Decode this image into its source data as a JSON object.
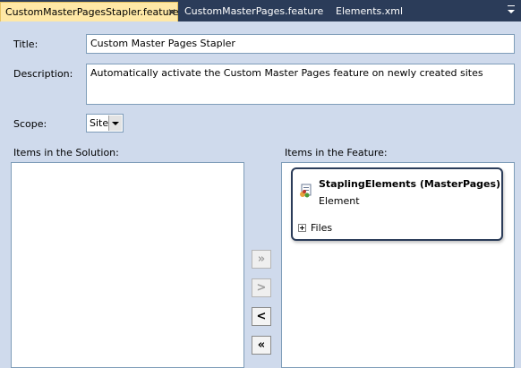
{
  "tabs": [
    {
      "label": "CustomMasterPagesStapler.feature",
      "active": true,
      "close_glyph": "✕"
    },
    {
      "label": "CustomMasterPages.feature",
      "active": false
    },
    {
      "label": "Elements.xml",
      "active": false
    }
  ],
  "tab_overflow_icon": "dropdown-icon",
  "form": {
    "title_label": "Title:",
    "title_value": "Custom Master Pages Stapler",
    "description_label": "Description:",
    "description_value": "Automatically activate the Custom Master Pages feature on newly created sites",
    "scope_label": "Scope:",
    "scope_value": "Site"
  },
  "solution_items": {
    "label": "Items in the Solution:",
    "items": []
  },
  "feature_items": {
    "label": "Items in the Feature:",
    "items": [
      {
        "title": "StaplingElements (MasterPages)",
        "type": "Element",
        "children_label": "Files",
        "icon": "feature-element-icon"
      }
    ]
  },
  "move_buttons": [
    {
      "name": "add-all-button",
      "glyph": "»",
      "enabled": false
    },
    {
      "name": "add-button",
      "glyph": ">",
      "enabled": false
    },
    {
      "name": "remove-button",
      "glyph": "<",
      "enabled": true
    },
    {
      "name": "remove-all-button",
      "glyph": "«",
      "enabled": true
    }
  ],
  "colors": {
    "background": "#CFDAEC",
    "tabstrip": "#2B3C59",
    "active_tab": "#FFE8A6",
    "field_border": "#7F9DB9"
  }
}
